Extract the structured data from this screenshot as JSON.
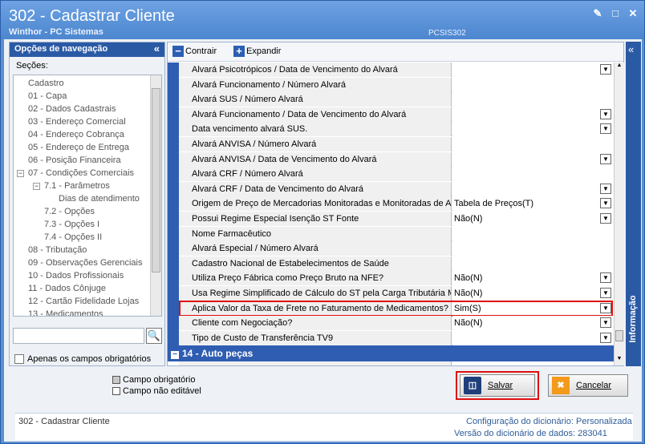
{
  "window": {
    "title": "302 - Cadastrar Cliente",
    "subtitle": "Winthor - PC Sistemas",
    "code": "PCSIS302"
  },
  "nav": {
    "header": "Opções de navegação",
    "sections_label": "Seções:",
    "items": [
      "Cadastro",
      "01 - Capa",
      "02 - Dados Cadastrais",
      "03 - Endereço Comercial",
      "04 - Endereço Cobrança",
      "05 - Endereço de Entrega",
      "06 - Posição Financeira",
      "07 - Condições Comerciais",
      "7.1 - Parâmetros",
      "Dias de atendimento",
      "7.2 - Opções",
      "7.3 - Opções I",
      "7.4 - Opções II",
      "08 - Tributação",
      "09 - Observações Gerenciais",
      "10 - Dados Profissionais",
      "11 - Dados Cônjuge",
      "12 - Cartão Fidelidade Lojas",
      "13 - Medicamentos"
    ],
    "only_required_label": "Apenas os campos obrigatórios"
  },
  "toolbar": {
    "collapse_label": "Contrair",
    "expand_label": "Expandir"
  },
  "grid": {
    "rows": [
      {
        "label": "Alvará Psicotrópicos / Data  de Vencimento do Alvará",
        "value": "",
        "dropdown": true
      },
      {
        "label": "Alvará Funcionamento / Número Alvará",
        "value": "",
        "dropdown": false
      },
      {
        "label": "Alvará SUS / Número Alvará",
        "value": "",
        "dropdown": false
      },
      {
        "label": "Alvará Funcionamento / Data  de Vencimento do Alvará",
        "value": "",
        "dropdown": true
      },
      {
        "label": "Data vencimento alvará SUS.",
        "value": "",
        "dropdown": true
      },
      {
        "label": "Alvará ANVISA / Número Alvará",
        "value": "",
        "dropdown": false
      },
      {
        "label": "Alvará ANVISA / Data  de Vencimento do Alvará",
        "value": "",
        "dropdown": true
      },
      {
        "label": "Alvará CRF / Número Alvará",
        "value": "",
        "dropdown": false
      },
      {
        "label": "Alvará CRF / Data  de Vencimento do Alvará",
        "value": "",
        "dropdown": true
      },
      {
        "label": "Origem de Preço de Mercadorias Monitoradas e Monitoradas de Alt",
        "value": "Tabela de Preços(T)",
        "dropdown": true
      },
      {
        "label": "Possui Regime Especial Isenção ST Fonte",
        "value": "Não(N)",
        "dropdown": true
      },
      {
        "label": "Nome Farmacêutico",
        "value": "",
        "dropdown": false
      },
      {
        "label": "Alvará Especial / Número Alvará",
        "value": "",
        "dropdown": false
      },
      {
        "label": "Cadastro Nacional de Estabelecimentos de Saúde",
        "value": "",
        "dropdown": false
      },
      {
        "label": "Utiliza Preço Fábrica como Preço Bruto na NFE?",
        "value": "Não(N)",
        "dropdown": true
      },
      {
        "label": "Usa Regime Simplificado de Cálculo do ST pela Carga Tributária Méc",
        "value": "Não(N)",
        "dropdown": true
      },
      {
        "label": "Aplica Valor da Taxa de Frete no Faturamento de Medicamentos?",
        "value": "Sim(S)",
        "dropdown": true
      },
      {
        "label": "Cliente com Negociação?",
        "value": "Não(N)",
        "dropdown": true
      },
      {
        "label": "Tipo de Custo de Transferência TV9",
        "value": "",
        "dropdown": true
      }
    ],
    "group_header": "14 - Auto peças"
  },
  "info_panel": {
    "label": "Informação"
  },
  "legend": {
    "required_label": "Campo obrigatório",
    "not_editable_label": "Campo não editável"
  },
  "actions": {
    "save_label": "Salvar",
    "cancel_label": "Cancelar"
  },
  "status": {
    "screen_title": "302 - Cadastrar Cliente",
    "dict_config_label": "Configuração do dicionário:",
    "dict_config_value": "Personalizada",
    "dict_version_label": "Versão do dicionário de dados:",
    "dict_version_value": "283041"
  },
  "colors": {
    "title_bar": "#4c86cf",
    "nav_header": "#2b5aa5",
    "grid_bar": "#2f5db2",
    "highlight": "#e01010"
  },
  "icons": {
    "save": "floppy-disk-icon",
    "cancel": "x-icon",
    "search": "magnifier-icon"
  }
}
